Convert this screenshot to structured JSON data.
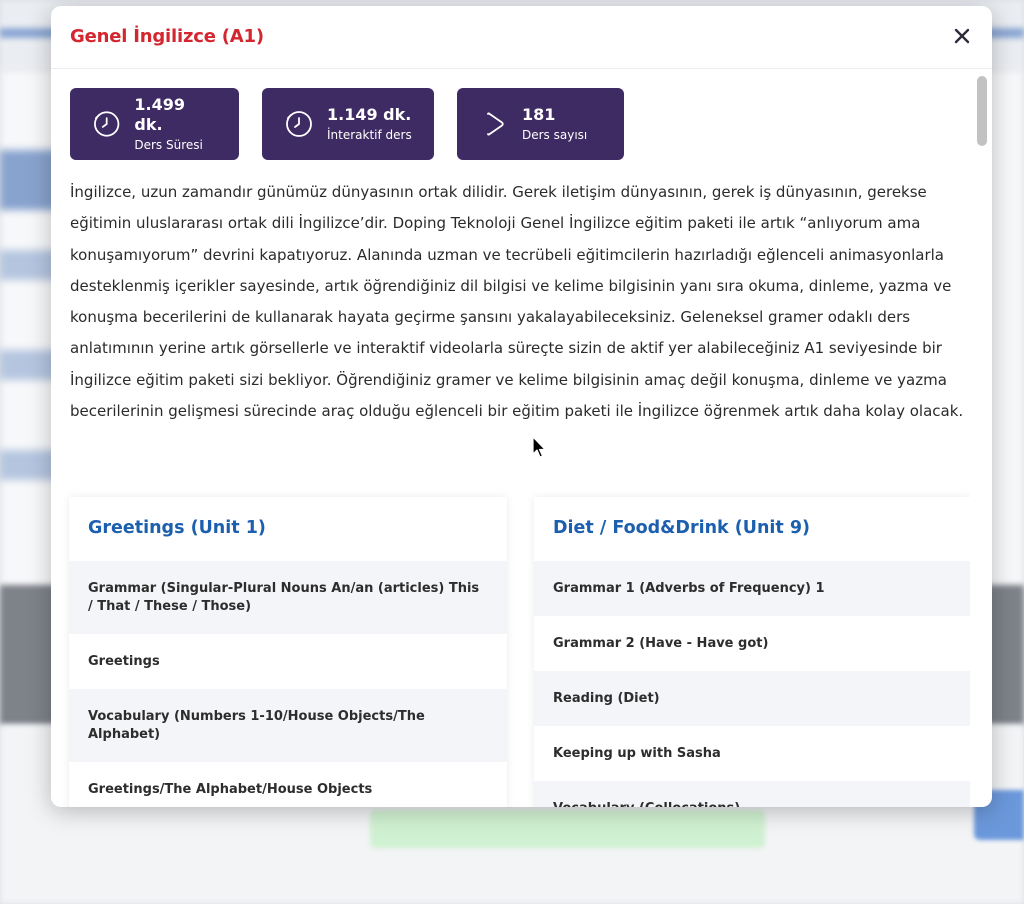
{
  "modal": {
    "title": "Genel İngilizce (A1)",
    "close_label": "×"
  },
  "stats": [
    {
      "value": "1.499 dk.",
      "label": "Ders Süresi",
      "icon": "clock-icon"
    },
    {
      "value": "1.149 dk.",
      "label": "İnteraktif ders",
      "icon": "clock-icon"
    },
    {
      "value": "181",
      "label": "Ders sayısı",
      "icon": "play-icon"
    }
  ],
  "description": "İngilizce, uzun zamandır günümüz dünyasının ortak dilidir. Gerek iletişim dünyasının, gerek iş dünyasının, gerekse eğitimin uluslararası ortak dili İngilizce’dir. Doping Teknoloji Genel İngilizce eğitim paketi ile artık “anlıyorum ama konuşamıyorum” devrini kapatıyoruz. Alanında uzman ve tecrübeli eğitimcilerin hazırladığı eğlenceli animasyonlarla desteklenmiş içerikler sayesinde, artık öğrendiğiniz dil bilgisi ve kelime bilgisinin yanı sıra okuma, dinleme, yazma ve konuşma becerilerini de kullanarak hayata geçirme şansını yakalayabileceksiniz. Geleneksel gramer odaklı ders anlatımının yerine artık görsellerle ve interaktif videolarla süreçte sizin de aktif yer alabileceğiniz A1 seviyesinde bir İngilizce eğitim paketi sizi bekliyor. Öğrendiğiniz gramer ve kelime bilgisinin amaç değil konuşma, dinleme ve yazma becerilerinin gelişmesi sürecinde araç olduğu eğlenceli bir eğitim paketi ile İngilizce öğrenmek artık daha kolay olacak.",
  "units": [
    {
      "title": "Greetings (Unit 1)",
      "lessons": [
        "Grammar (Singular-Plural Nouns An/an (articles) This / That / These / Those)",
        "Greetings",
        "Vocabulary (Numbers 1-10/House Objects/The Alphabet)",
        "Greetings/The Alphabet/House Objects"
      ]
    },
    {
      "title": "Diet / Food&Drink (Unit 9)",
      "lessons": [
        "Grammar 1 (Adverbs of Frequency) 1",
        "Grammar 2 (Have - Have got)",
        "Reading (Diet)",
        "Keeping up with Sasha",
        "Vocabulary (Collocations)"
      ]
    }
  ],
  "colors": {
    "title_red": "#d4262e",
    "stat_purple": "#3f2b63",
    "unit_blue": "#1b5fae"
  }
}
